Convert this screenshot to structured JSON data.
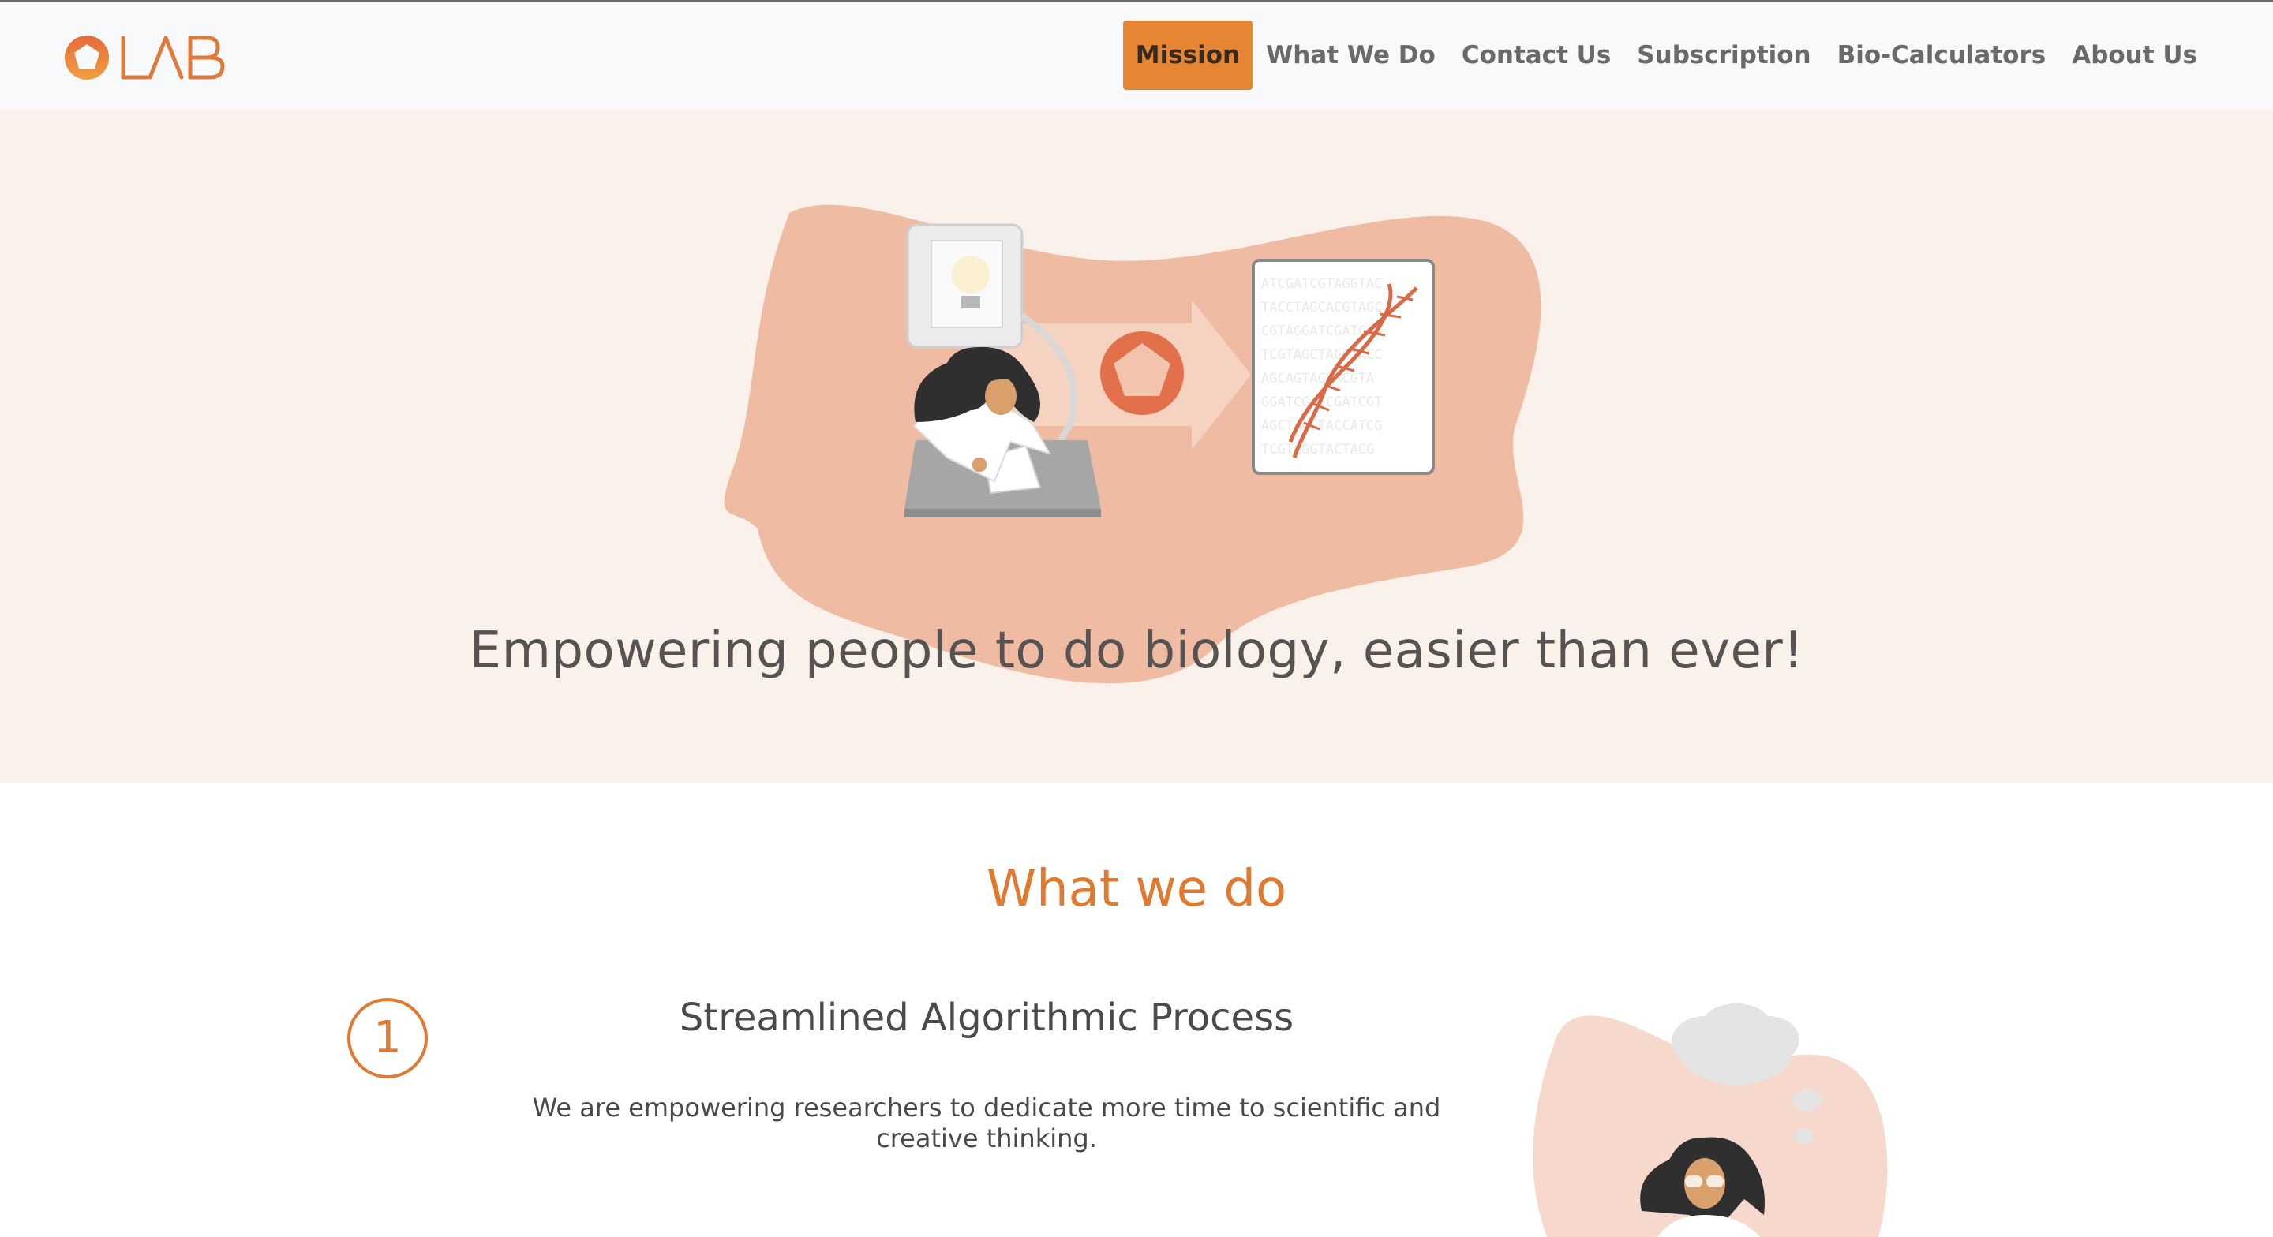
{
  "header": {
    "logo_text": "OLAB",
    "nav": [
      {
        "label": "Mission",
        "active": true
      },
      {
        "label": "What We Do",
        "active": false
      },
      {
        "label": "Contact Us",
        "active": false
      },
      {
        "label": "Subscription",
        "active": false
      },
      {
        "label": "Bio-Calculators",
        "active": false
      },
      {
        "label": "About Us",
        "active": false
      }
    ]
  },
  "hero": {
    "tagline": "Empowering people to do biology, easier than ever!"
  },
  "what_we_do": {
    "title": "What we do",
    "step": {
      "number": "1",
      "title": "Streamlined Algorithmic Process",
      "description": "We are empowering researchers to dedicate more time to scientific and creative thinking."
    }
  },
  "colors": {
    "accent": "#e68534",
    "hero_bg": "#faf1ea",
    "blob": "#efbca3",
    "text": "#575352"
  },
  "icons": [
    "olab-logo",
    "lightbulb-icon",
    "pentagon-icon",
    "dna-icon",
    "scientist-illustration",
    "thinking-scientist-illustration"
  ]
}
